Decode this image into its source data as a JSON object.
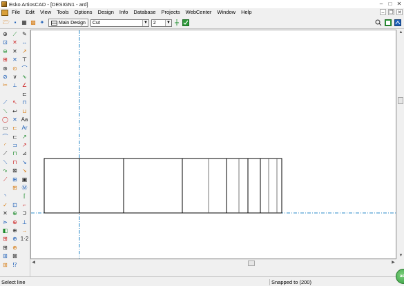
{
  "window": {
    "title": "Esko ArtiosCAD - [DESIGN1 - ard]",
    "min_glyph": "–",
    "max_glyph": "□",
    "close_glyph": "✕"
  },
  "menu": {
    "items": [
      "File",
      "Edit",
      "View",
      "Tools",
      "Options",
      "Design",
      "Info",
      "Database",
      "Projects",
      "WebCenter",
      "Window",
      "Help"
    ],
    "mdi_min": "–",
    "mdi_restore": "❐",
    "mdi_close": "✕"
  },
  "toolbar": {
    "main_design_label": "Main Design",
    "layer_value": "Cut",
    "linetype_value": "2",
    "icons": {
      "open": "🗁",
      "save": "▪",
      "b3": "▦",
      "b4": "▩",
      "b5": "✦"
    }
  },
  "palette": {
    "rows": [
      [
        "⊕",
        "⟋",
        "✎"
      ],
      [
        "⊡",
        "✕",
        "↔"
      ],
      [
        "⊖",
        "✕",
        "↗"
      ],
      [
        "⊞",
        "✕",
        "⊤"
      ],
      [
        "⊛",
        "⊙",
        "⌒"
      ],
      [
        "⊘",
        "∨",
        "∿"
      ],
      [
        "✂",
        "⟂",
        "∠"
      ],
      [
        "",
        "",
        "⊏"
      ],
      [
        "⟋",
        "↖",
        "⊓"
      ],
      [
        "⟍",
        "↩",
        "⊔"
      ],
      [
        "◯",
        "✕",
        "Aa"
      ],
      [
        "▭",
        "⊏",
        "Ar"
      ],
      [
        "⌒",
        "⊏",
        "↗"
      ],
      [
        "◜",
        "⊐",
        "↗"
      ],
      [
        "⟋",
        "⊓",
        "⊿"
      ],
      [
        "⟍",
        "⊓",
        "↘"
      ],
      [
        "∿",
        "⊠",
        "↘"
      ],
      [
        "⟋",
        "⊞",
        "▣"
      ],
      [
        "",
        "⊞",
        "Ⓜ"
      ],
      [
        "◝",
        "",
        "⌈"
      ],
      [
        "✓",
        "⊡",
        "⌐"
      ],
      [
        "✕",
        "⊕",
        "Ↄ"
      ],
      [
        "⋗",
        "⊕",
        "⊥"
      ],
      [
        "◧",
        "⊕",
        "→"
      ],
      [
        "⊞",
        "⊕",
        "1·2"
      ],
      [
        "⊞",
        "⊕",
        ""
      ],
      [
        "⊞",
        "⊠",
        ""
      ],
      [
        "⊞",
        "⁉",
        ""
      ]
    ]
  },
  "status": {
    "left": "Select line",
    "right": "Snapped to (200)"
  },
  "colors": {
    "guide": "#2a88c8",
    "drawing": "#000000",
    "fold": "#555555"
  }
}
